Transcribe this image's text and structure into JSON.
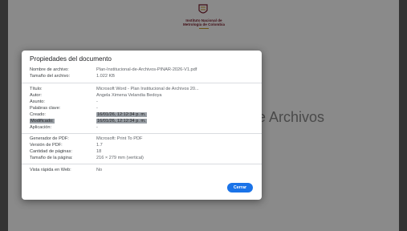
{
  "institution": {
    "name": "Instituto Nacional de\nMetrología de Colombia"
  },
  "background": {
    "title_visible": "e Archivos"
  },
  "dialog": {
    "title": "Propiedades del documento",
    "file_section": [
      {
        "label": "Nombre de archivo:",
        "value": "Plan-Institucional-de-Archivos-PINAR-2026-V1.pdf"
      },
      {
        "label": "Tamaño del archivo:",
        "value": "1.022 KB"
      }
    ],
    "doc_section": [
      {
        "label": "Título:",
        "value": "Microsoft Word - Plan Institucional de Archivos 20..."
      },
      {
        "label": "Autor:",
        "value": "Angela Ximena Velandia Bedoya"
      },
      {
        "label": "Asunto:",
        "value": "-"
      },
      {
        "label": "Palabras clave:",
        "value": "-"
      },
      {
        "label": "Creado:",
        "value": "16/01/26, 12:12:34 p. m."
      },
      {
        "label": "Modificado:",
        "value": "16/01/26, 12:12:34 p. m."
      },
      {
        "label": "Aplicación:",
        "value": "-"
      }
    ],
    "pdf_section": [
      {
        "label": "Generador de PDF:",
        "value": "Microsoft: Print To PDF"
      },
      {
        "label": "Versión de PDF:",
        "value": "1.7"
      },
      {
        "label": "Cantidad de páginas:",
        "value": "18"
      },
      {
        "label": "Tamaño de la página:",
        "value": "216 × 279 mm (vertical)"
      }
    ],
    "web_section": [
      {
        "label": "Vista rápida en Web:",
        "value": "No"
      }
    ],
    "close_label": "Cerrar"
  },
  "colors": {
    "accent": "#1a73e8",
    "institution": "#7a1b2a",
    "overlay": "#5f5f5f"
  },
  "icons": {
    "crest": "institution-crest-icon"
  }
}
